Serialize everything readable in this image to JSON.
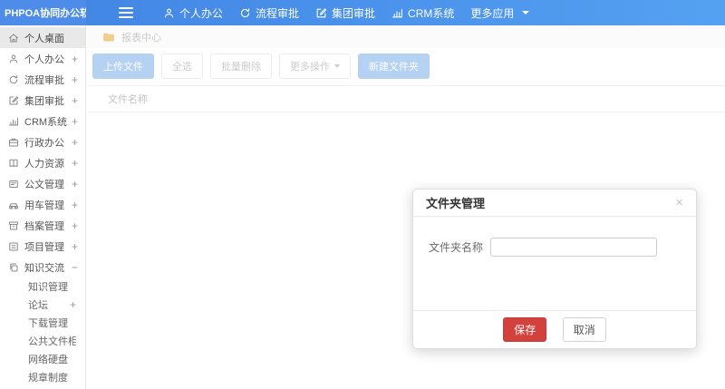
{
  "app": {
    "title": "PHPOA协同办公软件"
  },
  "topnav": {
    "items": [
      {
        "label": "个人办公",
        "icon": "user-icon",
        "caret": false
      },
      {
        "label": "流程审批",
        "icon": "flow-icon",
        "caret": false
      },
      {
        "label": "集团审批",
        "icon": "edit-icon",
        "caret": false
      },
      {
        "label": "CRM系统",
        "icon": "chart-icon",
        "caret": false
      },
      {
        "label": "更多应用",
        "icon": "",
        "caret": true
      }
    ]
  },
  "sidebar": {
    "items": [
      {
        "label": "个人桌面",
        "icon": "home-icon",
        "expand": "",
        "active": true
      },
      {
        "label": "个人办公",
        "icon": "user-icon",
        "expand": "+",
        "active": false
      },
      {
        "label": "流程审批",
        "icon": "flow-icon",
        "expand": "+",
        "active": false
      },
      {
        "label": "集团审批",
        "icon": "edit-icon",
        "expand": "+",
        "active": false
      },
      {
        "label": "CRM系统",
        "icon": "chart-icon",
        "expand": "+",
        "active": false
      },
      {
        "label": "行政办公",
        "icon": "briefcase-icon",
        "expand": "+",
        "active": false
      },
      {
        "label": "人力资源",
        "icon": "book-icon",
        "expand": "+",
        "active": false
      },
      {
        "label": "公文管理",
        "icon": "doc-icon",
        "expand": "+",
        "active": false
      },
      {
        "label": "用车管理",
        "icon": "car-icon",
        "expand": "+",
        "active": false
      },
      {
        "label": "档案管理",
        "icon": "archive-icon",
        "expand": "+",
        "active": false
      },
      {
        "label": "项目管理",
        "icon": "project-icon",
        "expand": "+",
        "active": false
      },
      {
        "label": "知识交流",
        "icon": "knowledge-icon",
        "expand": "−",
        "active": false,
        "children": [
          {
            "label": "知识管理",
            "expand": ""
          },
          {
            "label": "论坛",
            "expand": "+"
          },
          {
            "label": "下载管理",
            "expand": ""
          },
          {
            "label": "公共文件柜",
            "expand": ""
          },
          {
            "label": "网络硬盘",
            "expand": ""
          },
          {
            "label": "规章制度",
            "expand": ""
          }
        ]
      }
    ]
  },
  "breadcrumb": {
    "label": "报表中心",
    "icon": "folder-icon"
  },
  "toolbar": {
    "buttons": [
      {
        "label": "上传文件",
        "style": "primary",
        "caret": false
      },
      {
        "label": "全选",
        "style": "default",
        "caret": false
      },
      {
        "label": "批量删除",
        "style": "default",
        "caret": false
      },
      {
        "label": "更多操作",
        "style": "default",
        "caret": true
      },
      {
        "label": "新建文件夹",
        "style": "primary",
        "caret": false
      }
    ]
  },
  "table": {
    "header": "文件名称"
  },
  "modal": {
    "title": "文件夹管理",
    "close_icon": "×",
    "field_label": "文件夹名称",
    "input_value": "",
    "input_placeholder": "",
    "save_label": "保存",
    "cancel_label": "取消"
  },
  "colors": {
    "topbar_blue_start": "#4184e3",
    "topbar_blue_end": "#55a1f1",
    "logo_blue": "#4e8ce9",
    "primary_button_blue": "#b5d2f3",
    "save_red": "#d2413c",
    "active_item_gray": "#e9e9e9",
    "folder_yellow": "#f0cf8e"
  }
}
